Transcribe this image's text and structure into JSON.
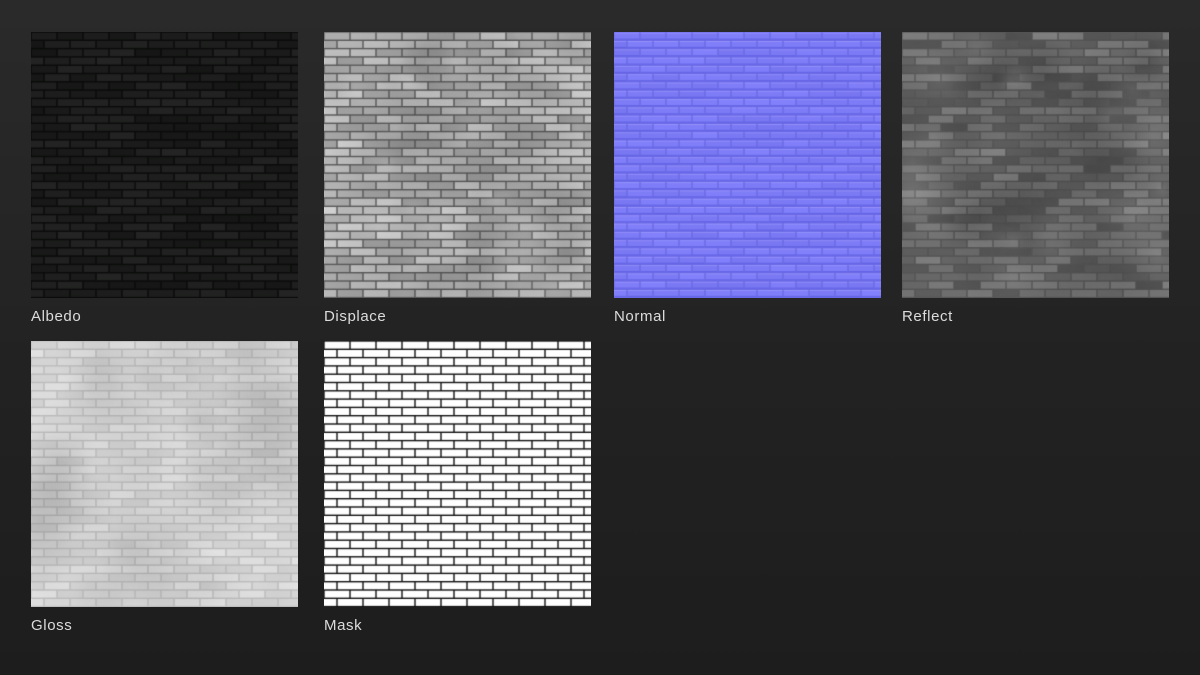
{
  "maps": [
    {
      "label": "Albedo",
      "kind": "albedo",
      "base": "#1c1d1c",
      "mortar": "#0b0b0b"
    },
    {
      "label": "Displace",
      "kind": "displace",
      "base": "#b8b8b8",
      "mortar": "#5a5a5a"
    },
    {
      "label": "Normal",
      "kind": "normal",
      "base": "#7d7cf6",
      "mortar": "#6a6ae6"
    },
    {
      "label": "Reflect",
      "kind": "reflect",
      "base": "#6a6a6a",
      "mortar": "#555555"
    },
    {
      "label": "Gloss",
      "kind": "gloss",
      "base": "#d9d9d9",
      "mortar": "#bcbcbc"
    },
    {
      "label": "Mask",
      "kind": "mask",
      "base": "#ffffff",
      "mortar": "#111111"
    }
  ]
}
